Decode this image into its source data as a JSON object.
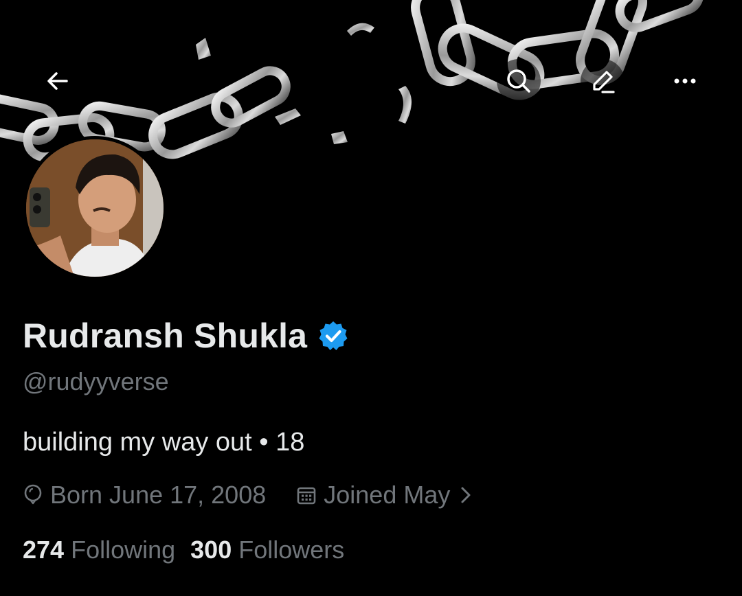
{
  "colors": {
    "background": "#000000",
    "primary_text": "#e7e9ea",
    "secondary_text": "#71767b",
    "verified_blue": "#1d9bf0"
  },
  "header": {
    "back_icon": "arrow-left-icon",
    "search_icon": "search-icon",
    "edit_icon": "pencil-icon",
    "more_icon": "more-horizontal-icon"
  },
  "profile": {
    "display_name": "Rudransh Shukla",
    "verified_icon": "verified-badge-icon",
    "handle": "@rudyyverse",
    "bio": "building my way out • 18",
    "birthday": "Born June 17, 2008",
    "joined": "Joined May",
    "following_count": "274",
    "following_label": "Following",
    "followers_count": "300",
    "followers_label": "Followers"
  }
}
